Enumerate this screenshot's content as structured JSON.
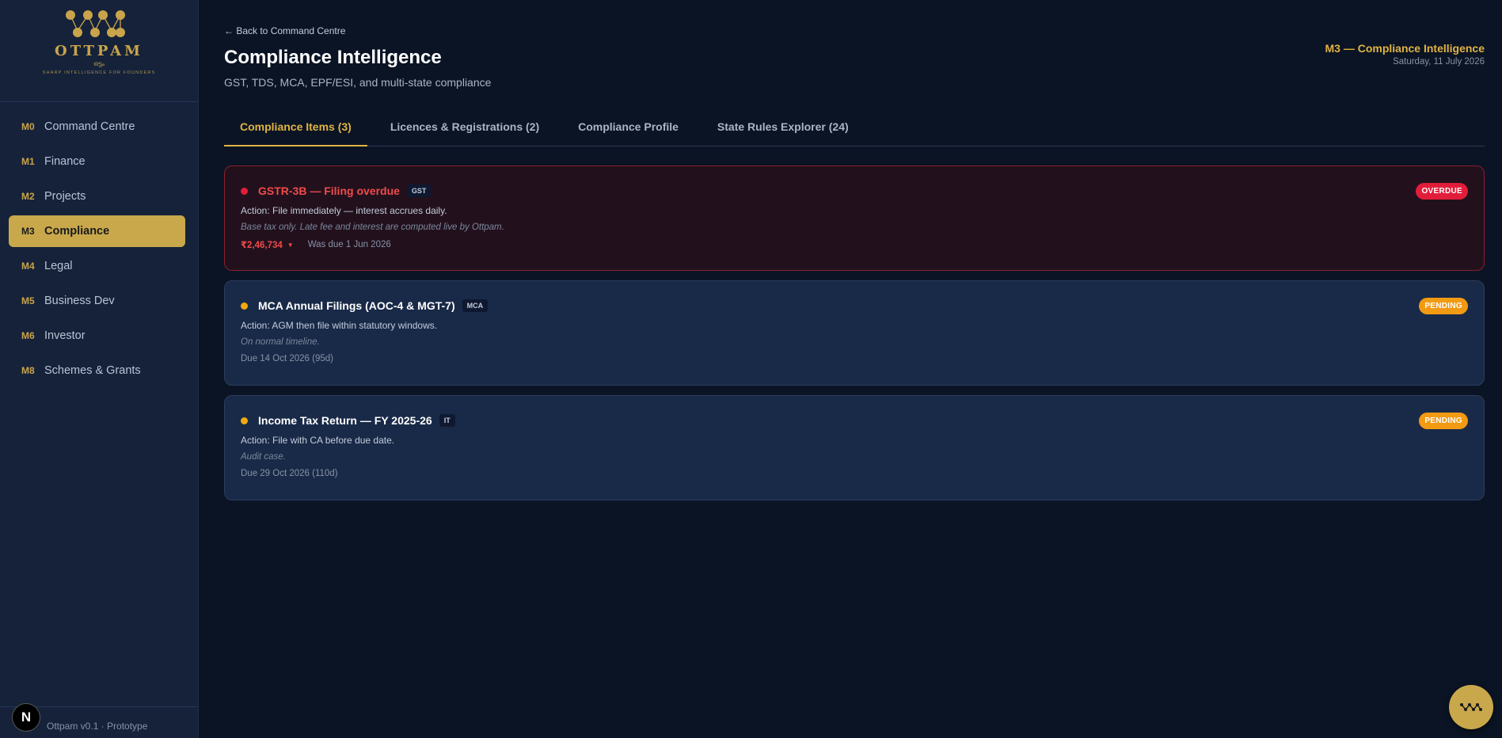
{
  "brand": {
    "name": "OTTPAM",
    "script": "ഒട്ടം",
    "tagline": "SHARP INTELLIGENCE FOR FOUNDERS",
    "version": "Ottpam v0.1 · Prototype",
    "badge_letter": "N"
  },
  "sidebar": {
    "items": [
      {
        "code": "M0",
        "label": "Command Centre"
      },
      {
        "code": "M1",
        "label": "Finance"
      },
      {
        "code": "M2",
        "label": "Projects"
      },
      {
        "code": "M3",
        "label": "Compliance"
      },
      {
        "code": "M4",
        "label": "Legal"
      },
      {
        "code": "M5",
        "label": "Business Dev"
      },
      {
        "code": "M6",
        "label": "Investor"
      },
      {
        "code": "M8",
        "label": "Schemes & Grants"
      }
    ],
    "active_index": 3
  },
  "header": {
    "back_link": "← Back to Command Centre",
    "title": "Compliance Intelligence",
    "subtitle": "GST, TDS, MCA, EPF/ESI, and multi-state compliance",
    "module": "M3 — Compliance Intelligence",
    "date": "Saturday, 11 July 2026"
  },
  "tabs": [
    {
      "label": "Compliance Items (3)"
    },
    {
      "label": "Licences & Registrations (2)"
    },
    {
      "label": "Compliance Profile"
    },
    {
      "label": "State Rules Explorer (24)"
    }
  ],
  "items": [
    {
      "title": "GSTR-3B — Filing overdue",
      "tag": "GST",
      "status": "OVERDUE",
      "action": "Action: File immediately — interest accrues daily.",
      "note": "Base tax only. Late fee and interest are computed live by Ottpam.",
      "amount": "₹2,46,734",
      "due": "Was due 1 Jun 2026"
    },
    {
      "title": "MCA Annual Filings (AOC-4 & MGT-7)",
      "tag": "MCA",
      "status": "PENDING",
      "action": "Action: AGM then file within statutory windows.",
      "note": "On normal timeline.",
      "due": "Due 14 Oct 2026 (95d)"
    },
    {
      "title": "Income Tax Return — FY 2025-26",
      "tag": "IT",
      "status": "PENDING",
      "action": "Action: File with CA before due date.",
      "note": "Audit case.",
      "due": "Due 29 Oct 2026 (110d)"
    }
  ],
  "colors": {
    "accent": "#c9a84c",
    "overdue": "#e11d3a",
    "pending": "#f29a12"
  }
}
